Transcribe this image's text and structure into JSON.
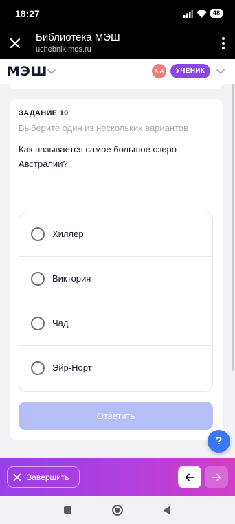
{
  "status_bar": {
    "time": "18:27",
    "battery": "48"
  },
  "browser": {
    "title": "Библиотека МЭШ",
    "url": "uchebnik.mos.ru"
  },
  "header": {
    "logo": "МЭШ",
    "avatar_initials": "А А",
    "role": "УЧЕНИК"
  },
  "task": {
    "number": "ЗАДАНИЕ 10",
    "hint": "Выберите один из нескольких вариантов",
    "question": "Как называется самое большое озеро Австралии?",
    "options": [
      {
        "label": "Хиллер"
      },
      {
        "label": "Виктория"
      },
      {
        "label": "Чад"
      },
      {
        "label": "Эйр-Норт"
      }
    ],
    "submit_label": "Ответить"
  },
  "help": {
    "label": "?"
  },
  "bottom_bar": {
    "finish_label": "Завершить"
  },
  "colors": {
    "accent": "#8b46e6",
    "submit_disabled": "#b5bef6",
    "help": "#3a78f2",
    "avatar": "#f07d79"
  }
}
